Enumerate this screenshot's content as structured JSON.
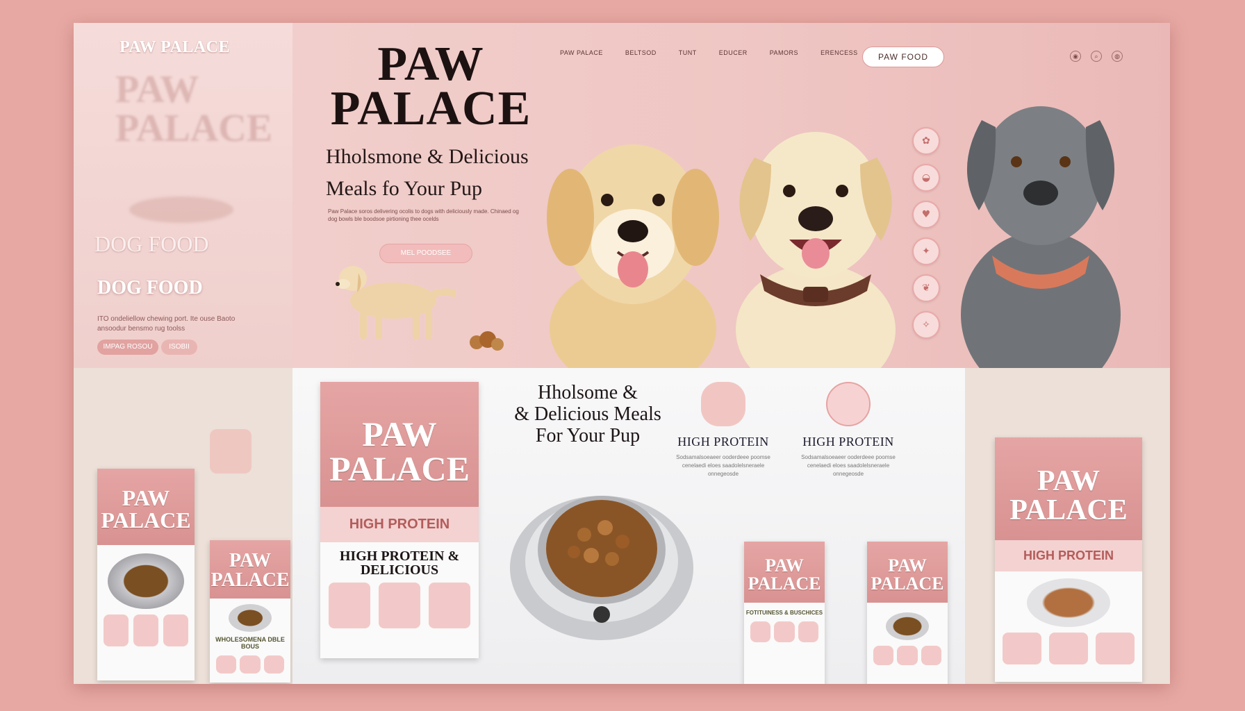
{
  "brand": "PAW PALACE",
  "left_panel": {
    "logo": "PAW PALACE",
    "ghost_logo": "PAW PALACE",
    "dog_food_1": "DOG FOOD",
    "dog_food_2": "DOG FOOD",
    "description": "ITO ondeliellow chewing port. Ite ouse Baoto ansoodur bensmo rug toolss",
    "button_1": "IMPAG ROSOU",
    "button_2": "ISOBII"
  },
  "nav": {
    "items": [
      "PAW PALACE",
      "BELTSOD",
      "TUNT",
      "EDUCER",
      "PAMORS",
      "ERENCESS"
    ],
    "cta": "PAW FOOD"
  },
  "hero": {
    "title_line1": "PAW",
    "title_line2": "PALACE",
    "subtitle_line1": "Hholsmone & Delicious",
    "subtitle_line2": "Meals fo Your Pup",
    "body": "Paw Palace soros delivering ocolis to dogs with deliciously made. Chinaed og dog bowls ble boodsoe pirtioning thee ocelds",
    "button": "MEL POODSEE"
  },
  "center": {
    "title_line1": "Hholsome &",
    "title_line2": "& Delicious Meals",
    "title_line3": "For Your Pup",
    "feature_1": "HIGH PROTEIN",
    "feature_2": "HIGH PROTEIN",
    "feature_text": "Sodsamalsoeaeer ooderdeee poomse cenelaedi eloes saadolelsneraele onnegeosde"
  },
  "packages": {
    "big_brand_1": "PAW",
    "big_brand_2": "PALACE",
    "big_band": "HIGH PROTEIN",
    "big_small": "HIGH PROTEIN & DELICIOUS",
    "left_brand_1": "PAW",
    "left_brand_2": "PALACE",
    "left_small_1": "PAW",
    "left_small_2": "PALACE",
    "left_small_text": "WHOLESOMENA DBLE BOUS",
    "mid1_1": "PAW",
    "mid1_2": "PALACE",
    "mid1_text": "FOTITUINESS & BUSCHICES",
    "mid2_1": "PAW",
    "mid2_2": "PALACE",
    "right_1": "PAW",
    "right_2": "PALACE",
    "right_band": "HIGH PROTEIN"
  },
  "colors": {
    "pink": "#e7a8a3",
    "pink_dark": "#d89291",
    "text_dark": "#1d1212"
  }
}
